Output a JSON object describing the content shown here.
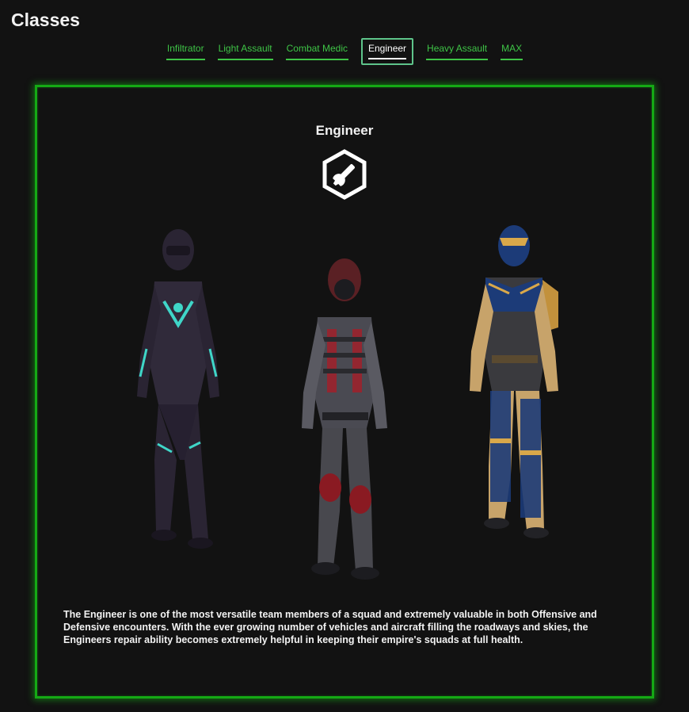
{
  "page": {
    "title": "Classes"
  },
  "tabs": [
    {
      "label": "Infiltrator",
      "active": false
    },
    {
      "label": "Light Assault",
      "active": false
    },
    {
      "label": "Combat Medic",
      "active": false
    },
    {
      "label": "Engineer",
      "active": true
    },
    {
      "label": "Heavy Assault",
      "active": false
    },
    {
      "label": "MAX",
      "active": false
    }
  ],
  "panel": {
    "class_name": "Engineer",
    "class_icon": "wrench-hexagon-icon",
    "figures": [
      {
        "name": "engineer-figure-purple-teal",
        "palette": [
          "#2a2433",
          "#3fd6c8"
        ]
      },
      {
        "name": "engineer-figure-red-grey",
        "palette": [
          "#4a4a52",
          "#a0202a"
        ]
      },
      {
        "name": "engineer-figure-blue-gold",
        "palette": [
          "#1c3b78",
          "#d9a84a"
        ]
      }
    ],
    "description": "The Engineer is one of the most versatile team members of a squad and extremely valuable in both Offensive and Defensive encounters. With the ever growing number of vehicles and aircraft filling the roadways and skies, the Engineers repair ability becomes extremely helpful in keeping their empire's squads at full health."
  },
  "colors": {
    "background": "#121212",
    "accent_green": "#3ec446",
    "panel_border": "#15a915",
    "text": "#f2f2f2"
  }
}
